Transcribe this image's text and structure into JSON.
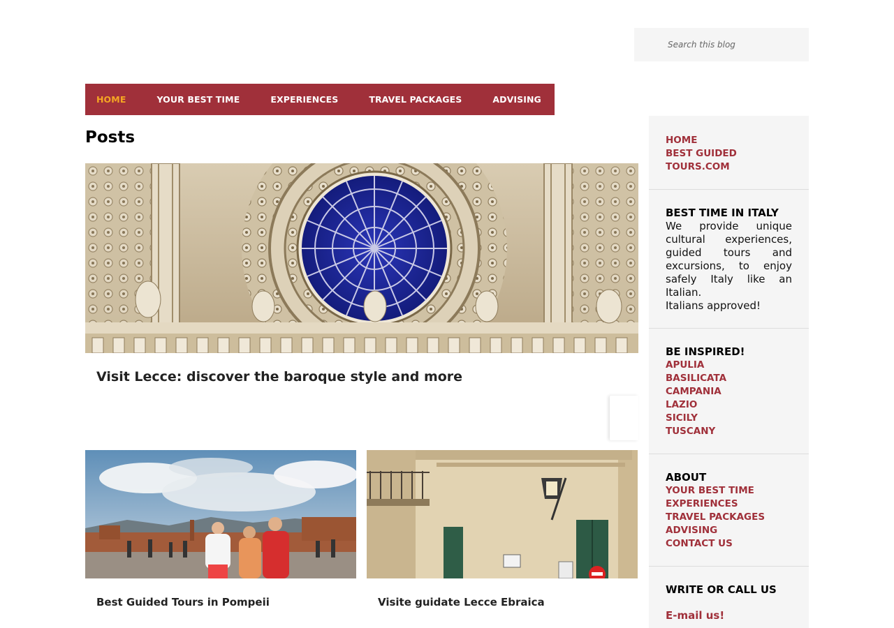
{
  "search": {
    "placeholder": "Search this blog"
  },
  "nav": {
    "items": [
      {
        "label": "HOME"
      },
      {
        "label": "YOUR BEST TIME"
      },
      {
        "label": "EXPERIENCES"
      },
      {
        "label": "TRAVEL PACKAGES"
      },
      {
        "label": "ADVISING"
      }
    ]
  },
  "main": {
    "title": "Posts",
    "featured": {
      "title": "Visit Lecce: discover the baroque style and more"
    },
    "cards": [
      {
        "title": "Best Guided Tours in Pompeii"
      },
      {
        "title": "Visite guidate Lecce Ebraica"
      }
    ]
  },
  "sidebar": {
    "home_links": [
      "HOME",
      "BEST GUIDED TOURS.COM"
    ],
    "best_time": {
      "heading": "BEST TIME IN ITALY",
      "text": "We provide unique cultural experiences, guided tours and excursions, to enjoy safely Italy like an Italian.",
      "text2": "Italians approved!"
    },
    "inspired": {
      "heading": "BE INSPIRED!",
      "links": [
        "APULIA",
        "BASILICATA",
        "CAMPANIA",
        "LAZIO",
        "SICILY",
        "TUSCANY"
      ]
    },
    "about": {
      "heading": "ABOUT",
      "links": [
        "YOUR BEST TIME",
        "EXPERIENCES",
        "TRAVEL PACKAGES",
        "ADVISING",
        "CONTACT US"
      ]
    },
    "contact": {
      "heading": "WRITE OR CALL US",
      "email_label": "E-mail us!"
    }
  },
  "colors": {
    "brand": "#a0303a",
    "active": "#f5a623",
    "sidebar_bg": "#f5f5f5"
  }
}
